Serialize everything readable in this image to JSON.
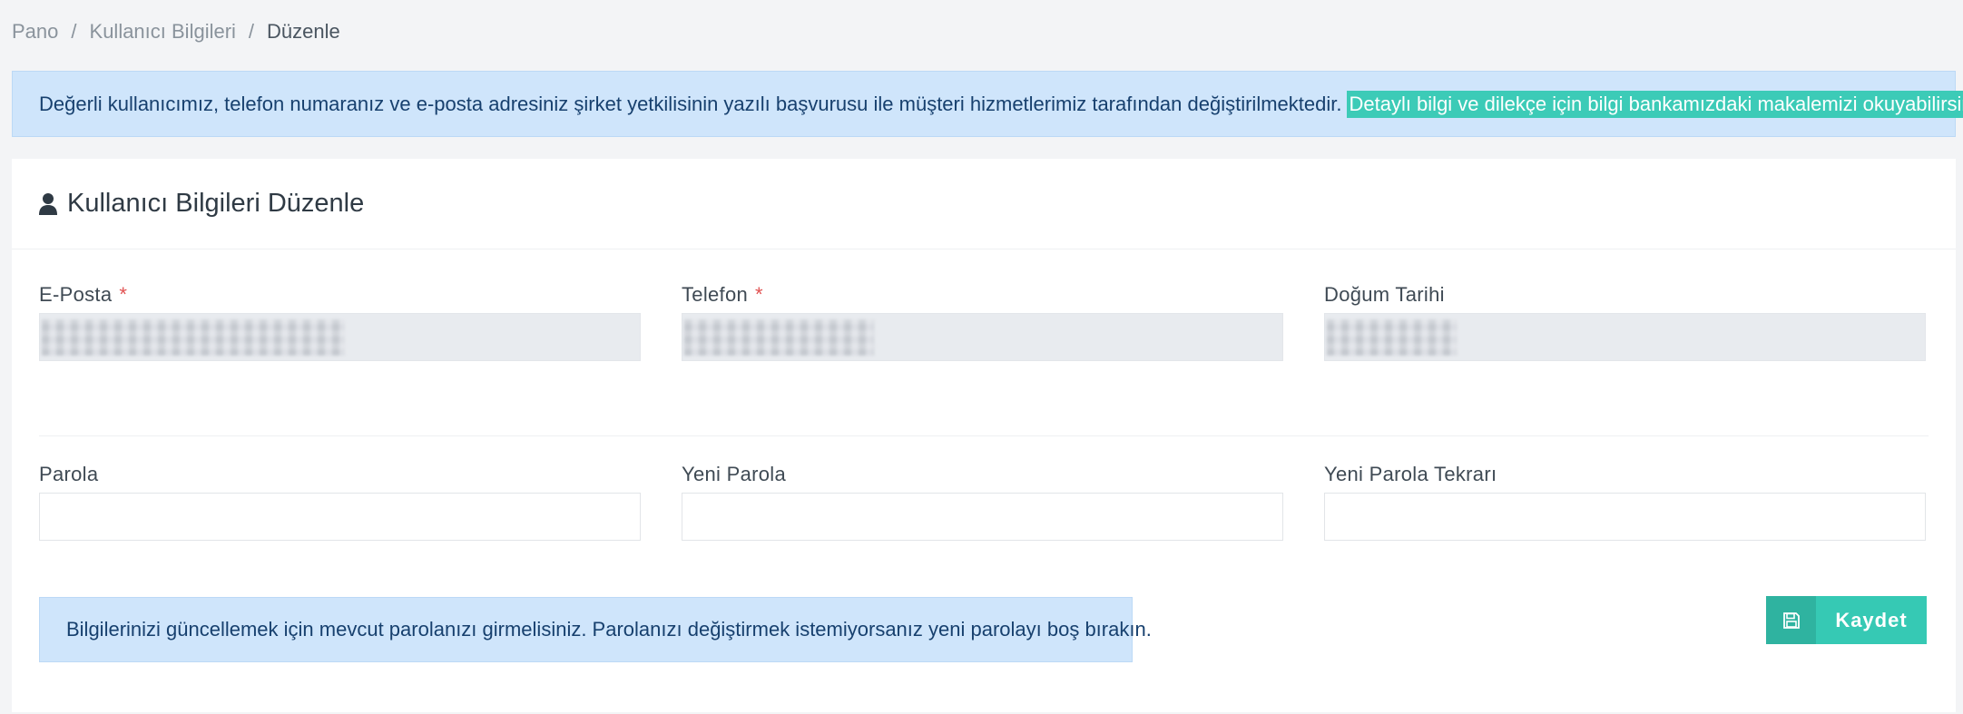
{
  "breadcrumb": {
    "items": [
      "Pano",
      "Kullanıcı Bilgileri",
      "Düzenle"
    ],
    "separator": "/"
  },
  "top_alert": {
    "text": "Değerli kullanıcımız, telefon numaranız ve e-posta adresiniz şirket yetkilisinin yazılı başvurusu ile müşteri hizmetlerimiz tarafından değiştirilmektedir.",
    "link_text": "Detaylı bilgi ve dilekçe için bilgi bankamızdaki makalemizi okuyabilirsiniz."
  },
  "card": {
    "title": "Kullanıcı Bilgileri Düzenle",
    "title_icon": "user-icon"
  },
  "fields": {
    "email": {
      "label": "E-Posta",
      "required_mark": "*",
      "value": ""
    },
    "phone": {
      "label": "Telefon",
      "required_mark": "*",
      "value": ""
    },
    "birthdate": {
      "label": "Doğum Tarihi",
      "value": ""
    },
    "password": {
      "label": "Parola",
      "value": ""
    },
    "new_password": {
      "label": "Yeni Parola",
      "value": ""
    },
    "new_password_repeat": {
      "label": "Yeni Parola Tekrarı",
      "value": ""
    }
  },
  "bottom_alert": {
    "text": "Bilgilerinizi güncellemek için mevcut parolanızı girmelisiniz. Parolanızı değiştirmek istemiyorsanız yeni parolayı boş bırakın."
  },
  "save_button": {
    "label": "Kaydet",
    "icon": "save-icon"
  },
  "colors": {
    "accent": "#36c9b4",
    "alert_bg": "#cfe5fb",
    "alert_text": "#17406e",
    "required": "#e15252"
  }
}
